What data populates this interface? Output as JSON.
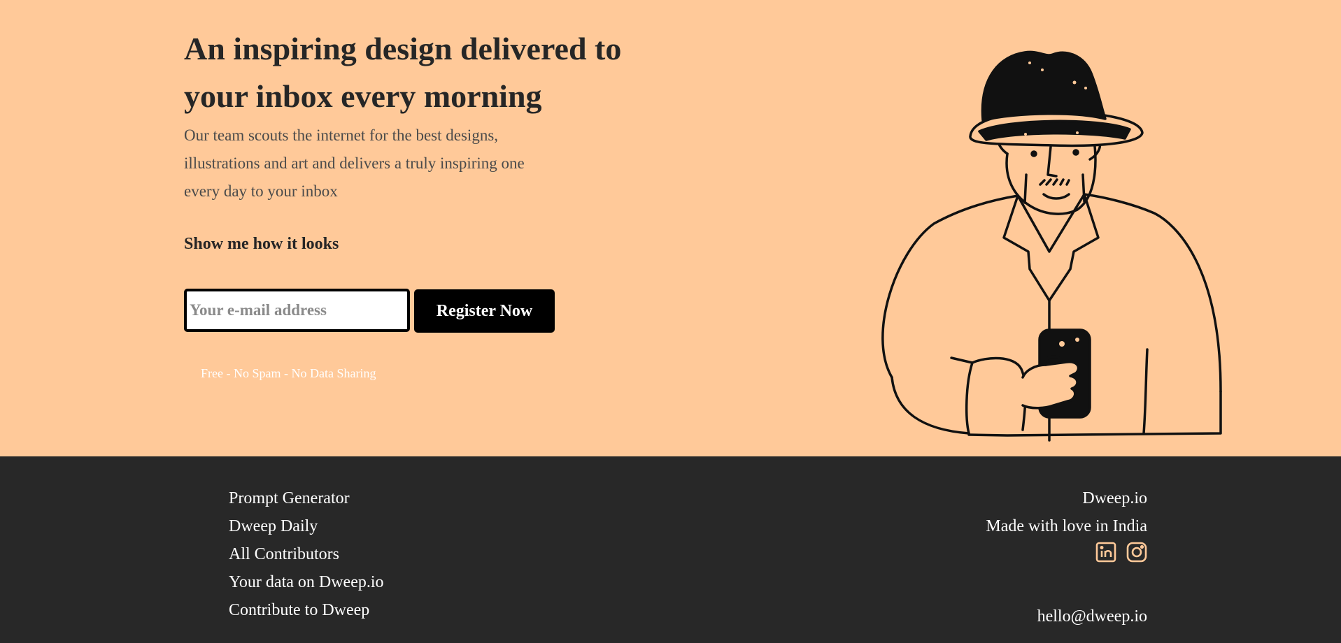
{
  "hero": {
    "headline": "An inspiring design delivered to your inbox every morning",
    "subtext": "Our team scouts the internet for the best designs, illustrations and art and delivers a truly inspiring one every day to your inbox",
    "show_link": "Show me how it looks",
    "email_placeholder": "Your e-mail address",
    "email_value": "",
    "register_label": "Register Now",
    "fineprint": "Free - No Spam - No Data Sharing",
    "illustration_icon": "man-with-hat-holding-phone-illustration"
  },
  "footer": {
    "links": [
      "Prompt Generator",
      "Dweep Daily",
      "All Contributors",
      "Your data on Dweep.io",
      "Contribute to Dweep"
    ],
    "brand": "Dweep.io",
    "tagline": "Made with love in India",
    "social": [
      {
        "icon": "linkedin-icon"
      },
      {
        "icon": "instagram-icon"
      }
    ],
    "email": "hello@dweep.io"
  },
  "colors": {
    "hero_bg": "#ffc999",
    "footer_bg": "#282828",
    "text_dark": "#262626",
    "button_bg": "#000000",
    "accent": "#ffc999"
  }
}
